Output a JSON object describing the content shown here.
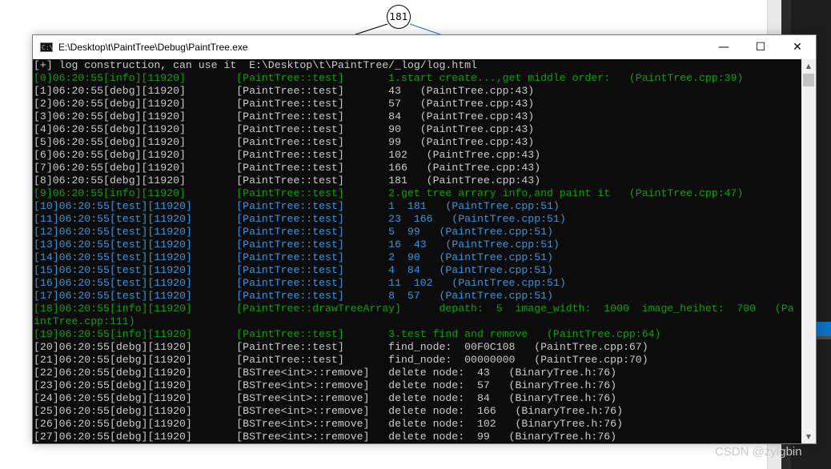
{
  "background": {
    "tree_node_label": "181"
  },
  "window": {
    "title": "E:\\Desktop\\t\\PaintTree\\Debug\\PaintTree.exe",
    "icon_text": "C:\\",
    "minimize_glyph": "—",
    "maximize_glyph": "☐",
    "close_glyph": "✕"
  },
  "console": {
    "lines": [
      {
        "type": "head",
        "text": "[+] log construction, can use it  E:\\Desktop\\t\\PaintTree/_log/log.html"
      },
      {
        "type": "info",
        "text": "[0]06:20:55[info][11920]        [PaintTree::test]       1.start create...,get middle order:   (PaintTree.cpp:39)"
      },
      {
        "type": "debg",
        "text": "[1]06:20:55[debg][11920]        [PaintTree::test]       43   (PaintTree.cpp:43)"
      },
      {
        "type": "debg",
        "text": "[2]06:20:55[debg][11920]        [PaintTree::test]       57   (PaintTree.cpp:43)"
      },
      {
        "type": "debg",
        "text": "[3]06:20:55[debg][11920]        [PaintTree::test]       84   (PaintTree.cpp:43)"
      },
      {
        "type": "debg",
        "text": "[4]06:20:55[debg][11920]        [PaintTree::test]       90   (PaintTree.cpp:43)"
      },
      {
        "type": "debg",
        "text": "[5]06:20:55[debg][11920]        [PaintTree::test]       99   (PaintTree.cpp:43)"
      },
      {
        "type": "debg",
        "text": "[6]06:20:55[debg][11920]        [PaintTree::test]       102   (PaintTree.cpp:43)"
      },
      {
        "type": "debg",
        "text": "[7]06:20:55[debg][11920]        [PaintTree::test]       166   (PaintTree.cpp:43)"
      },
      {
        "type": "debg",
        "text": "[8]06:20:55[debg][11920]        [PaintTree::test]       181   (PaintTree.cpp:43)"
      },
      {
        "type": "info",
        "text": "[9]06:20:55[info][11920]        [PaintTree::test]       2.get tree arrary info,and paint it   (PaintTree.cpp:47)"
      },
      {
        "type": "test",
        "text": "[10]06:20:55[test][11920]       [PaintTree::test]       1  181   (PaintTree.cpp:51)"
      },
      {
        "type": "test",
        "text": "[11]06:20:55[test][11920]       [PaintTree::test]       23  166   (PaintTree.cpp:51)"
      },
      {
        "type": "test",
        "text": "[12]06:20:55[test][11920]       [PaintTree::test]       5  99   (PaintTree.cpp:51)"
      },
      {
        "type": "test",
        "text": "[13]06:20:55[test][11920]       [PaintTree::test]       16  43   (PaintTree.cpp:51)"
      },
      {
        "type": "test",
        "text": "[14]06:20:55[test][11920]       [PaintTree::test]       2  90   (PaintTree.cpp:51)"
      },
      {
        "type": "test",
        "text": "[15]06:20:55[test][11920]       [PaintTree::test]       4  84   (PaintTree.cpp:51)"
      },
      {
        "type": "test",
        "text": "[16]06:20:55[test][11920]       [PaintTree::test]       11  102   (PaintTree.cpp:51)"
      },
      {
        "type": "test",
        "text": "[17]06:20:55[test][11920]       [PaintTree::test]       8  57   (PaintTree.cpp:51)"
      },
      {
        "type": "info",
        "text": "[18]06:20:55[info][11920]       [PaintTree::drawTreeArray]      depath:  5  image_width:  1000  image_heihet:  700   (Pa"
      },
      {
        "type": "info",
        "text": "intTree.cpp:111)"
      },
      {
        "type": "info",
        "text": "[19]06:20:55[info][11920]       [PaintTree::test]       3.test find and remove   (PaintTree.cpp:64)"
      },
      {
        "type": "debg",
        "text": "[20]06:20:55[debg][11920]       [PaintTree::test]       find_node:  00F0C108   (PaintTree.cpp:67)"
      },
      {
        "type": "debg",
        "text": "[21]06:20:55[debg][11920]       [PaintTree::test]       find_node:  00000000   (PaintTree.cpp:70)"
      },
      {
        "type": "debg",
        "text": "[22]06:20:55[debg][11920]       [BSTree<int>::remove]   delete node:  43   (BinaryTree.h:76)"
      },
      {
        "type": "debg",
        "text": "[23]06:20:55[debg][11920]       [BSTree<int>::remove]   delete node:  57   (BinaryTree.h:76)"
      },
      {
        "type": "debg",
        "text": "[24]06:20:55[debg][11920]       [BSTree<int>::remove]   delete node:  84   (BinaryTree.h:76)"
      },
      {
        "type": "debg",
        "text": "[25]06:20:55[debg][11920]       [BSTree<int>::remove]   delete node:  166   (BinaryTree.h:76)"
      },
      {
        "type": "debg",
        "text": "[26]06:20:55[debg][11920]       [BSTree<int>::remove]   delete node:  102   (BinaryTree.h:76)"
      },
      {
        "type": "debg",
        "text": "[27]06:20:55[debg][11920]       [BSTree<int>::remove]   delete node:  99   (BinaryTree.h:76)"
      }
    ]
  },
  "colors": {
    "info": "#13a10e",
    "debg": "#cccccc",
    "test": "#3a96dd",
    "console_bg": "#0c0c0c"
  },
  "watermark": "CSDN @zylgbin"
}
